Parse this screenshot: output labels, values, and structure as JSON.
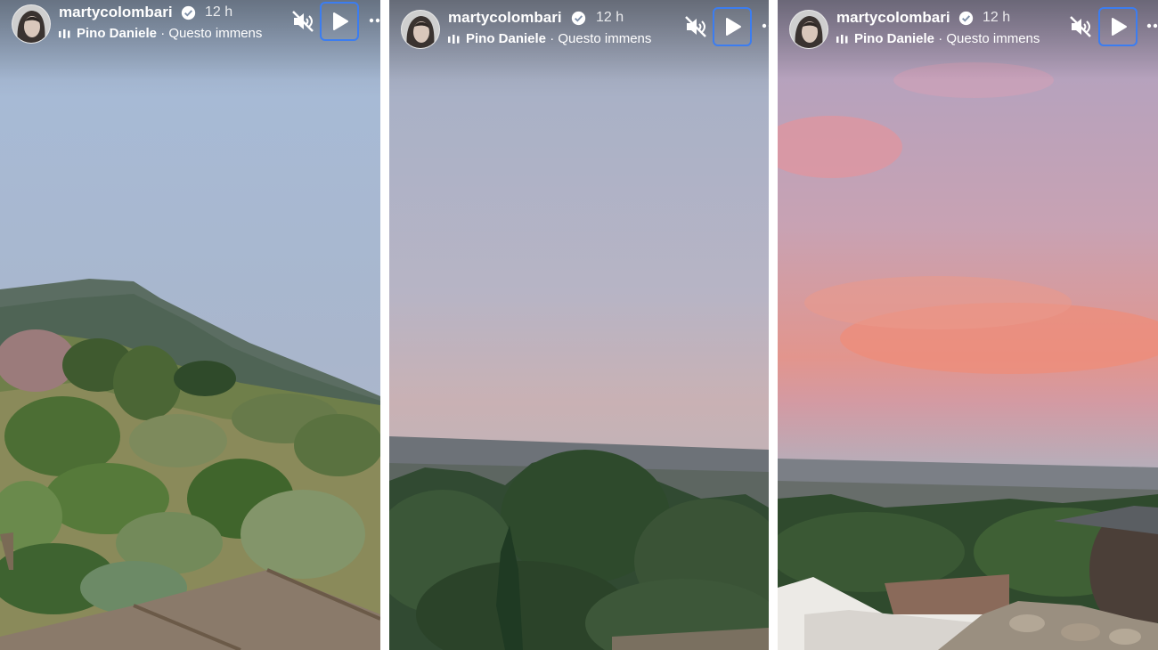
{
  "stories": [
    {
      "username": "martycolombari",
      "time": "12 h",
      "music_artist": "Pino Daniele",
      "music_track": "· Questo immens"
    },
    {
      "username": "martycolombari",
      "time": "12 h",
      "music_artist": "Pino Daniele",
      "music_track": "· Questo immens"
    },
    {
      "username": "martycolombari",
      "time": "12 h",
      "music_artist": "Pino Daniele",
      "music_track": "· Questo immens"
    }
  ],
  "icons": {
    "verified": "verified-badge-icon",
    "mute": "muted-speaker-icon",
    "play": "play-icon",
    "more": "more-options-icon",
    "music": "music-bars-icon"
  },
  "colors": {
    "focus_outline": "#3c7df0",
    "text": "#ffffff"
  }
}
